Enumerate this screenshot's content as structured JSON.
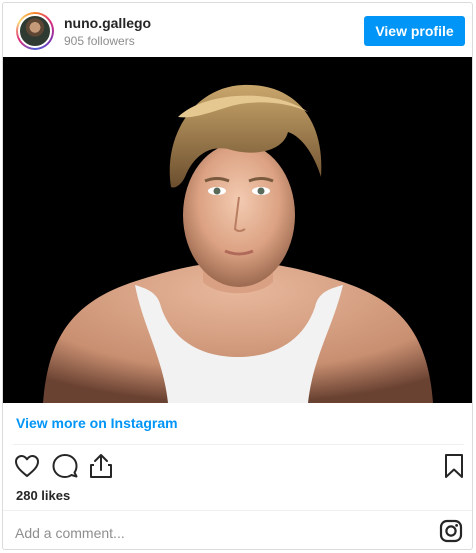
{
  "profile": {
    "username": "nuno.gallego",
    "followers": "905 followers",
    "view_profile_label": "View profile"
  },
  "post": {
    "view_more_label": "View more on Instagram",
    "likes": "280 likes",
    "comment_placeholder": "Add a comment...",
    "icons": [
      "heart-icon",
      "comment-icon",
      "share-icon",
      "bookmark-icon",
      "instagram-icon"
    ]
  },
  "colors": {
    "accent": "#0095f6",
    "text": "#262626",
    "muted": "#8e8e8e",
    "border": "#dbdbdb"
  }
}
